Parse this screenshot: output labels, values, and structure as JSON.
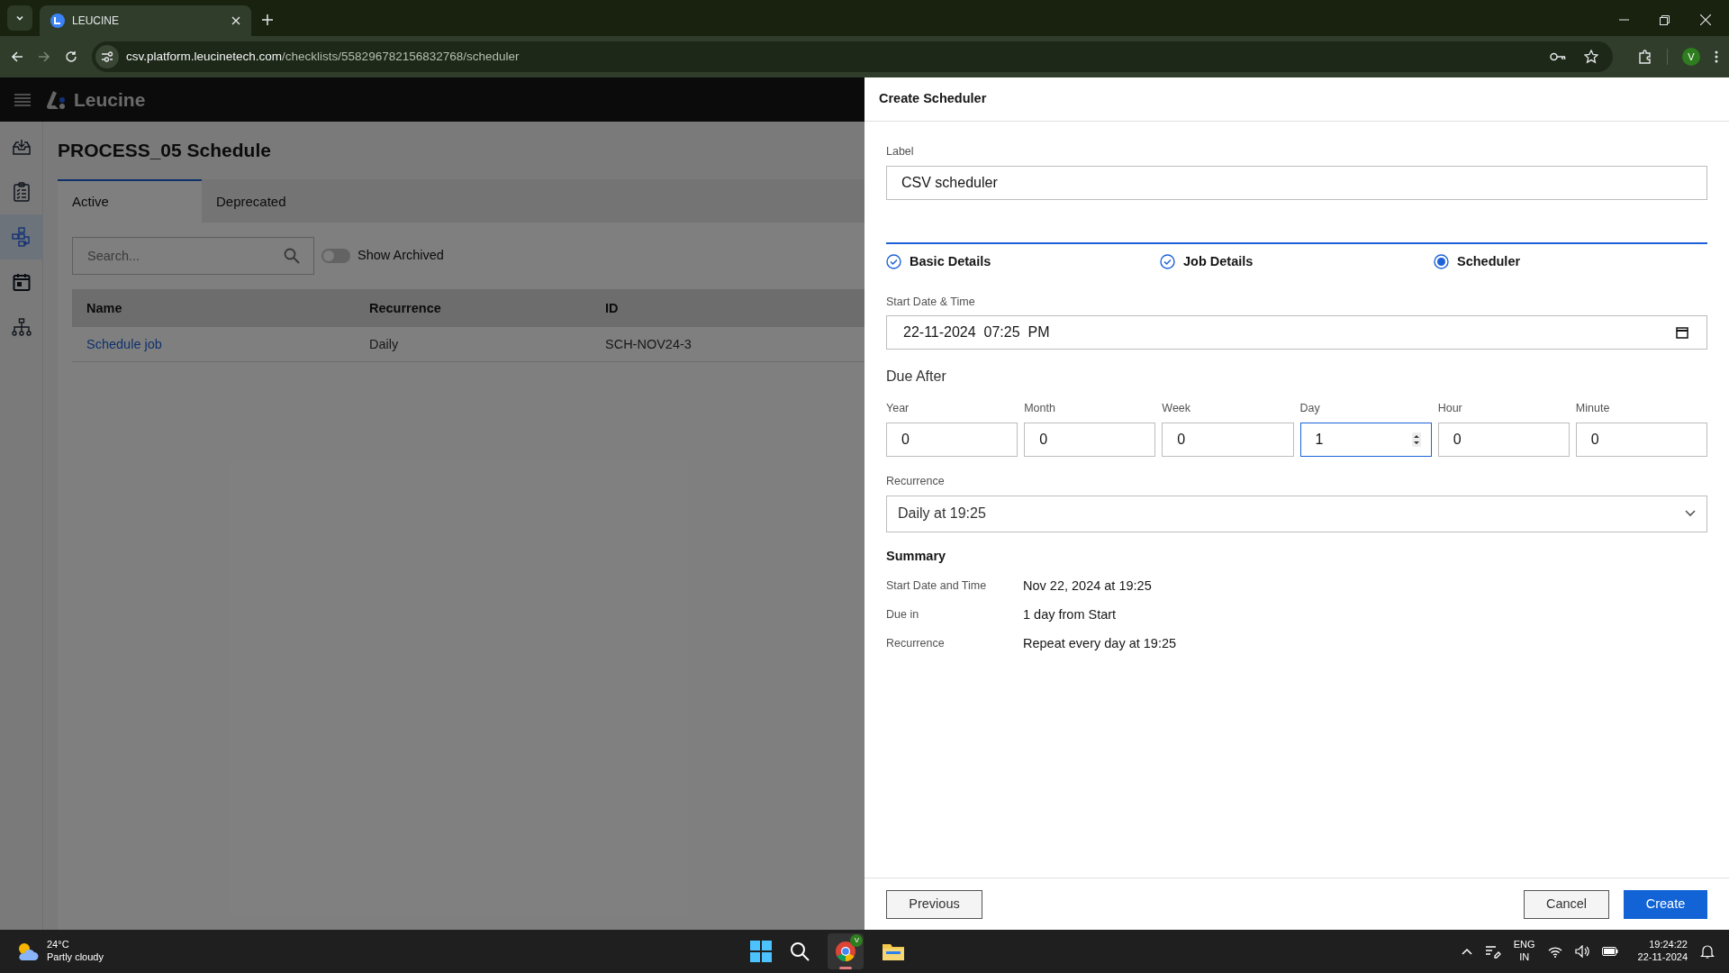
{
  "browser": {
    "tab_title": "LEUCINE",
    "url": {
      "host": "csv.platform.leucinetech.com",
      "path": "/checklists/558296782156832768/scheduler"
    },
    "profile_initial": "V"
  },
  "app": {
    "logo": "Leucine",
    "sidebar": [
      {
        "kind": "inbox",
        "selected": false
      },
      {
        "kind": "checklist",
        "selected": false
      },
      {
        "kind": "flow",
        "selected": true
      },
      {
        "kind": "calendar",
        "selected": false
      },
      {
        "kind": "hierarchy",
        "selected": false
      }
    ],
    "page_title": "PROCESS_05 Schedule",
    "tabs": [
      {
        "label": "Active",
        "selected": true
      },
      {
        "label": "Deprecated",
        "selected": false
      }
    ],
    "search": {
      "placeholder": "Search..."
    },
    "show_archived": {
      "label": "Show Archived",
      "on": false
    },
    "table": {
      "columns": [
        "Name",
        "Recurrence",
        "ID"
      ],
      "rows": [
        {
          "name": "Schedule job",
          "recurrence": "Daily",
          "id": "SCH-NOV24-3"
        }
      ]
    }
  },
  "drawer": {
    "title": "Create Scheduler",
    "label_field": {
      "label": "Label",
      "value": "CSV scheduler"
    },
    "steps": [
      {
        "label": "Basic Details",
        "completed": true,
        "selected": false
      },
      {
        "label": "Job Details",
        "completed": true,
        "selected": false
      },
      {
        "label": "Scheduler",
        "completed": false,
        "selected": true
      }
    ],
    "start_field": {
      "label": "Start Date & Time",
      "value": "22-11-2024  07:25  PM"
    },
    "due_after": {
      "title": "Due After",
      "fields": [
        {
          "label": "Year",
          "value": "0",
          "focused": false
        },
        {
          "label": "Month",
          "value": "0",
          "focused": false
        },
        {
          "label": "Week",
          "value": "0",
          "focused": false
        },
        {
          "label": "Day",
          "value": "1",
          "focused": true
        },
        {
          "label": "Hour",
          "value": "0",
          "focused": false
        },
        {
          "label": "Minute",
          "value": "0",
          "focused": false
        }
      ]
    },
    "recurrence": {
      "label": "Recurrence",
      "value": "Daily at 19:25"
    },
    "summary": {
      "title": "Summary",
      "rows": [
        {
          "label": "Start Date and Time",
          "value": "Nov 22, 2024 at 19:25"
        },
        {
          "label": "Due in",
          "value": "1 day from Start"
        },
        {
          "label": "Recurrence",
          "value": "Repeat every day at 19:25"
        }
      ]
    },
    "buttons": {
      "previous": "Previous",
      "cancel": "Cancel",
      "create": "Create"
    }
  },
  "taskbar": {
    "weather": {
      "temp": "24°C",
      "condition": "Partly cloudy"
    },
    "chrome_badge": "V",
    "language": [
      "ENG",
      "IN"
    ],
    "time": "19:24:22",
    "date": "22-11-2024"
  }
}
